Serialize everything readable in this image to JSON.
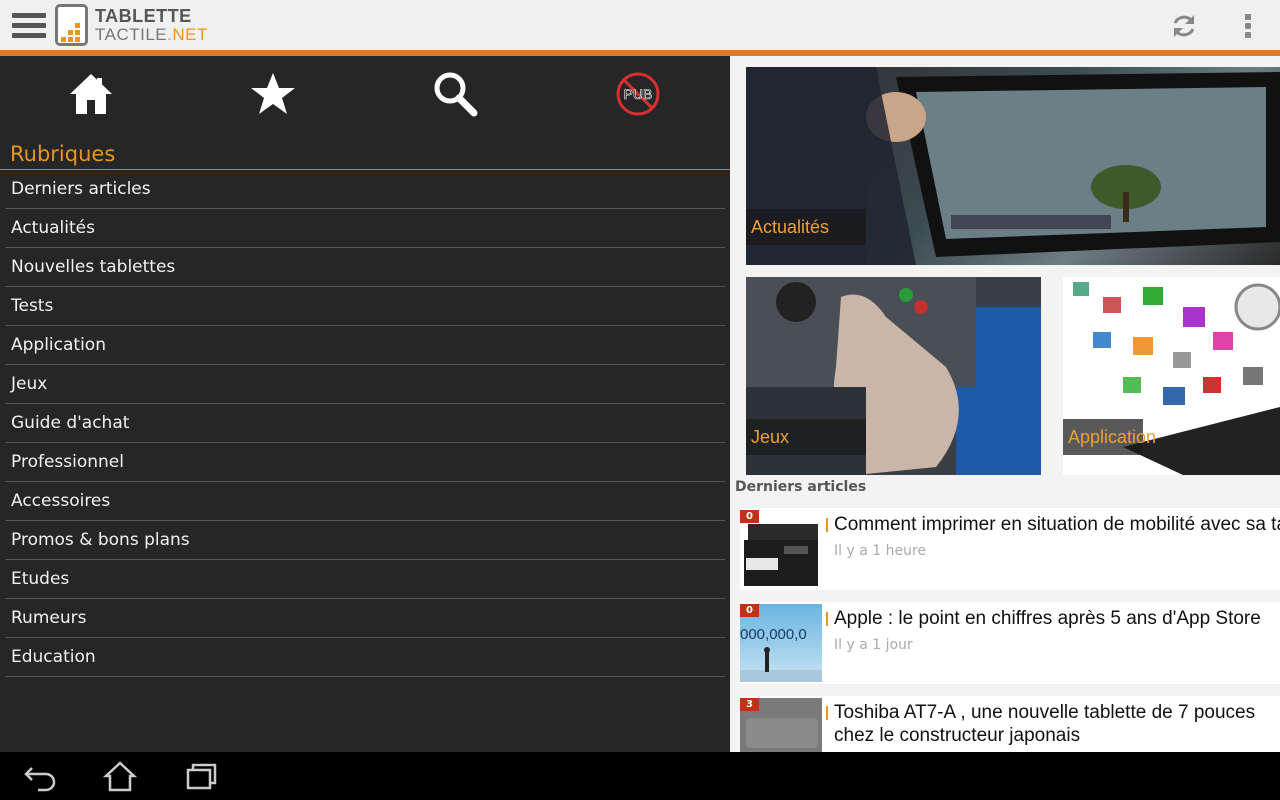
{
  "app": {
    "logo_line1": "TABLETTE",
    "logo_line2_main": "TACTILE",
    "logo_line2_accent": ".NET",
    "accent_color": "#e8761e"
  },
  "actionbar": {
    "icons": [
      "menu-icon",
      "refresh-icon",
      "overflow-menu-icon"
    ]
  },
  "drawer": {
    "top_icons": [
      "home-icon",
      "star-icon",
      "search-icon",
      "no-ads-icon"
    ],
    "no_ads_label": "PUB",
    "section_title": "Rubriques",
    "items": [
      "Derniers articles",
      "Actualités",
      "Nouvelles tablettes",
      "Tests",
      "Application",
      "Jeux",
      "Guide d'achat",
      "Professionnel",
      "Accessoires",
      "Promos & bons plans",
      "Etudes",
      "Rumeurs",
      "Education"
    ]
  },
  "tiles": {
    "featured": "Actualités",
    "left": "Jeux",
    "right": "Application"
  },
  "latest": {
    "section_title": "Derniers articles",
    "articles": [
      {
        "badge": "0",
        "title": "Comment imprimer en situation de mobilité avec sa tablette ?",
        "time": "Il y a 1 heure"
      },
      {
        "badge": "0",
        "title": "Apple : le point en chiffres après 5 ans d'App Store",
        "time": "Il y a 1 jour"
      },
      {
        "badge": "3",
        "title": "Toshiba AT7-A , une nouvelle tablette de 7 pouces chez le constructeur japonais",
        "time": ""
      }
    ],
    "thumb_text": "000,000,0"
  },
  "navbar": {
    "icons": [
      "back-icon",
      "home-icon",
      "recent-apps-icon"
    ]
  }
}
